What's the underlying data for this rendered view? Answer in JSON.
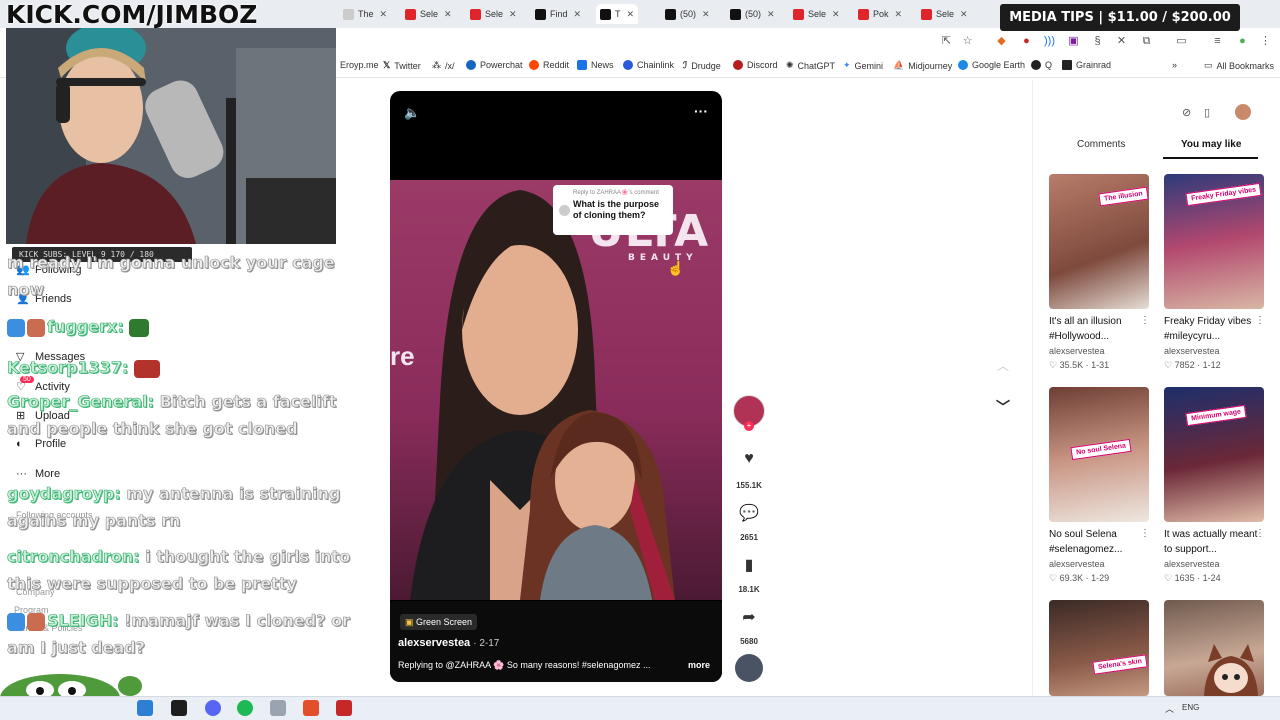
{
  "overlay": {
    "kick_title": "KICK.COM/JIMBOZ",
    "media_tips": "MEDIA TIPS | $11.00 / $200.00",
    "subs_bar": "KICK SUBS: LEVEL 9 170 / 180"
  },
  "tabs": [
    {
      "label": "The"
    },
    {
      "label": "Sele"
    },
    {
      "label": "Sele"
    },
    {
      "label": "Find"
    },
    {
      "label": "T"
    },
    {
      "label": "(50)"
    },
    {
      "label": "(50)"
    },
    {
      "label": "Sele"
    },
    {
      "label": "Pok"
    },
    {
      "label": "Sele"
    }
  ],
  "bookmarks": [
    {
      "label": "Eroyp.me"
    },
    {
      "label": "Twitter"
    },
    {
      "label": "/x/"
    },
    {
      "label": "Powerchat"
    },
    {
      "label": "Reddit"
    },
    {
      "label": "News"
    },
    {
      "label": "Chainlink"
    },
    {
      "label": "Drudge"
    },
    {
      "label": "Discord"
    },
    {
      "label": "ChatGPT"
    },
    {
      "label": "Gemini"
    },
    {
      "label": "Midjourney"
    },
    {
      "label": "Google Earth"
    },
    {
      "label": "Q"
    },
    {
      "label": "Grainrad"
    },
    {
      "label": "All Bookmarks"
    }
  ],
  "ghost_sidebar": {
    "following": "Following",
    "friends": "Friends",
    "messages": "Messages",
    "messages_badge": "50",
    "activity": "Activity",
    "upload": "Upload",
    "profile": "Profile",
    "more": "More",
    "following_accounts": "Following accounts",
    "company": "Company",
    "program": "Program",
    "terms": "Terms & Policies"
  },
  "chat": [
    {
      "user": "",
      "text": "m ready I'm gonna unlock your cage now"
    },
    {
      "user": "fuggerx:",
      "text": ""
    },
    {
      "user": "Ketsorp1337:",
      "text": ""
    },
    {
      "user": "Groper_General:",
      "text": "Bitch gets a facelift and people think she got cloned"
    },
    {
      "user": "goydagroyp:",
      "text": "my antenna is straining agains my pants rn"
    },
    {
      "user": "citronchadron:",
      "text": "i thought the girls into this were supposed to be pretty"
    },
    {
      "user": "SLEIGH:",
      "text": "!mamajf was I cloned? or am I just dead?"
    }
  ],
  "video": {
    "ulta_text": "ULTA",
    "ulta_sub": "BEAUTY",
    "left_text": "re",
    "comment_reply": "Reply to ZAHRAA🌸's comment",
    "comment_question": "What is the purpose of cloning them?",
    "green_screen": "Green Screen",
    "author": "alexservestea",
    "date": "· 2-17",
    "caption": "Replying to @ZAHRAA 🌸  So many reasons! #selenagomez ...",
    "more": "more"
  },
  "rail": {
    "likes": "155.1K",
    "comments": "2651",
    "saves": "18.1K",
    "shares": "5680"
  },
  "right_panel": {
    "tab_comments": "Comments",
    "tab_you_may_like": "You may like",
    "cards": [
      {
        "title": "It's all an illusion #Hollywood...",
        "author": "alexservestea",
        "likes": "35.5K",
        "date": "1-31",
        "sticker": "The illusion"
      },
      {
        "title": "Freaky Friday vibes #mileycyru...",
        "author": "alexservestea",
        "likes": "7852",
        "date": "1-12",
        "sticker": "Freaky Friday vibes"
      },
      {
        "title": "No soul Selena #selenagomez...",
        "author": "alexservestea",
        "likes": "69.3K",
        "date": "1-29",
        "sticker": "No soul Selena"
      },
      {
        "title": "It was actually meant to support...",
        "author": "alexservestea",
        "likes": "1635",
        "date": "1-24",
        "sticker": "Minimum wage"
      },
      {
        "title": "",
        "author": "",
        "likes": "",
        "date": "",
        "sticker": "Selena's skin"
      },
      {
        "title": "",
        "author": "",
        "likes": "",
        "date": "",
        "sticker": ""
      }
    ]
  },
  "taskbar": {
    "lang": "ENG"
  }
}
